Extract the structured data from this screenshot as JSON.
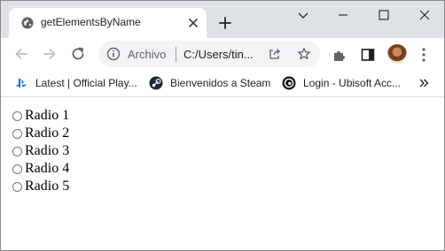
{
  "tab": {
    "title": "getElementsByName"
  },
  "omnibox": {
    "scheme_label": "Archivo",
    "url": "C:/Users/tin..."
  },
  "bookmarks": [
    {
      "label": "Latest | Official Play...",
      "icon": "playstation-icon"
    },
    {
      "label": "Bienvenidos a Steam",
      "icon": "steam-icon"
    },
    {
      "label": "Login - Ubisoft Acc...",
      "icon": "ubisoft-icon"
    }
  ],
  "radios": [
    {
      "label": "Radio 1",
      "checked": false
    },
    {
      "label": "Radio 2",
      "checked": false
    },
    {
      "label": "Radio 3",
      "checked": false
    },
    {
      "label": "Radio 4",
      "checked": false
    },
    {
      "label": "Radio 5",
      "checked": false
    }
  ],
  "colors": {
    "tabstrip": "#dee1e6",
    "omnibox": "#f1f3f4",
    "icon": "#5f6368",
    "radio_border": "#767676"
  }
}
